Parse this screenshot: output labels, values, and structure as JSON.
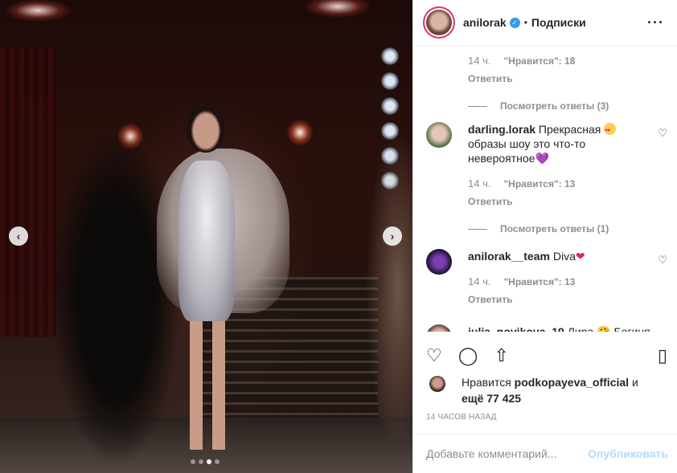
{
  "post": {
    "photo_alt": "",
    "carousel": {
      "count": 4,
      "active": 2
    },
    "nav": {
      "prev": "‹",
      "next": "›"
    }
  },
  "header": {
    "username": "anilorak",
    "verified_mark": "✓",
    "separator": "•",
    "follow_label": "Подписки",
    "more_label": "···"
  },
  "comments": [
    {
      "id": "c0",
      "partial": true,
      "time": "14 ч.",
      "likes": "\"Нравится\": 18",
      "reply": "Ответить",
      "view_replies": "Посмотреть ответы (3)"
    },
    {
      "id": "c1",
      "username": "darling.lorak",
      "text_before": "Прекрасная",
      "text_after": " образы шоу это что-то невероятное",
      "trailing_emoji": "💜",
      "time": "14 ч.",
      "likes": "\"Нравится\": 13",
      "reply": "Ответить",
      "view_replies": "Посмотреть ответы (1)"
    },
    {
      "id": "c2",
      "username": "anilorak__team",
      "text": "Diva",
      "trailing_emoji": "❤",
      "time": "14 ч.",
      "likes": "\"Нравится\": 13",
      "reply": "Ответить"
    },
    {
      "id": "c3",
      "partial": true,
      "username": "julia_novikova_19",
      "text": "Лира 🤗 Богиня"
    }
  ],
  "actions": {
    "like_icon": "heart-outline",
    "comment_icon": "speech-bubble",
    "share_icon": "share-upload",
    "save_icon": "bookmark"
  },
  "likes": {
    "prefix": "Нравится ",
    "user": "podkopayeva_official",
    "middle": " и",
    "others": "ещё 77 425"
  },
  "timestamp": "14 ЧАСОВ НАЗАД",
  "comment_input": {
    "placeholder": "Добавьте комментарий...",
    "post_label": "Опубликовать"
  },
  "colors": {
    "link_disabled": "#b3dbff",
    "verified": "#3897f0",
    "muted_text": "#8e8e8e"
  }
}
